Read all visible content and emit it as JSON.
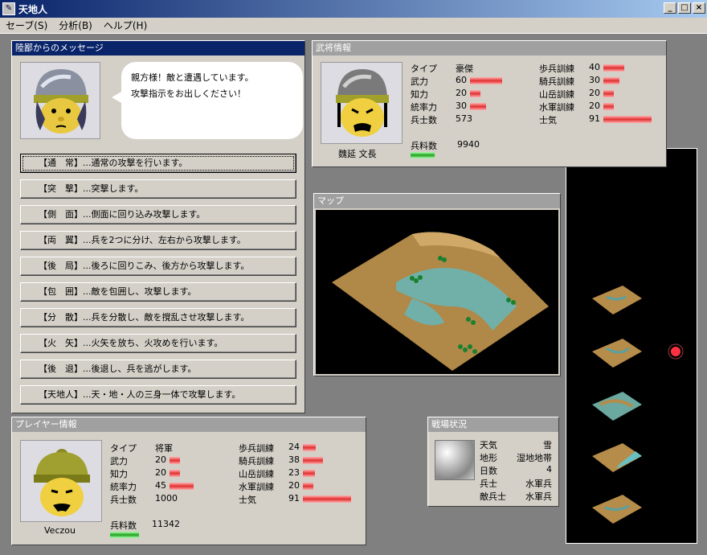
{
  "window": {
    "title": "天地人",
    "min": "_",
    "max": "□",
    "close": "×"
  },
  "menu": [
    "セーブ(S)",
    "分析(B)",
    "ヘルプ(H)"
  ],
  "message": {
    "header": "陸鄙からのメッセージ",
    "line1": "親方様！敵と遭遇しています。",
    "line2": "攻撃指示をお出しください！",
    "commands": [
      "【通　常】...通常の攻撃を行います。",
      "【突　撃】...突撃します。",
      "【側　面】...側面に回り込み攻撃します。",
      "【両　翼】...兵を2つに分け、左右から攻撃します。",
      "【後　局】...後ろに回りこみ、後方から攻撃します。",
      "【包　囲】...敵を包囲し、攻撃します。",
      "【分　散】...兵を分散し、敵を撹乱させ攻撃します。",
      "【火　矢】...火矢を放ち、火攻めを行います。",
      "【後　退】...後退し、兵を逃がします。",
      "【天地人】...天・地・人の三身一体で攻撃します。"
    ]
  },
  "general": {
    "header": "武将情報",
    "name": "魏延 文長",
    "left": [
      {
        "label": "タイプ",
        "value": "豪傑",
        "bar": null
      },
      {
        "label": "武力",
        "value": "60",
        "bar": 0.6
      },
      {
        "label": "知力",
        "value": "20",
        "bar": 0.2
      },
      {
        "label": "統率力",
        "value": "30",
        "bar": 0.3
      },
      {
        "label": "兵士数",
        "value": "573",
        "bar": null
      }
    ],
    "right": [
      {
        "label": "歩兵訓練",
        "value": "40",
        "bar": 0.4
      },
      {
        "label": "騎兵訓練",
        "value": "30",
        "bar": 0.3
      },
      {
        "label": "山岳訓練",
        "value": "20",
        "bar": 0.2
      },
      {
        "label": "水軍訓練",
        "value": "20",
        "bar": 0.2
      },
      {
        "label": "士気",
        "value": "91",
        "bar": 0.91
      }
    ],
    "food_label": "兵料数",
    "food_value": "9940"
  },
  "map": {
    "header": "マップ"
  },
  "player": {
    "header": "プレイヤー情報",
    "name": "Veczou",
    "left": [
      {
        "label": "タイプ",
        "value": "将軍",
        "bar": null
      },
      {
        "label": "武力",
        "value": "20",
        "bar": 0.2
      },
      {
        "label": "知力",
        "value": "20",
        "bar": 0.2
      },
      {
        "label": "統率力",
        "value": "45",
        "bar": 0.45
      },
      {
        "label": "兵士数",
        "value": "1000",
        "bar": null
      }
    ],
    "right": [
      {
        "label": "歩兵訓練",
        "value": "24",
        "bar": 0.24
      },
      {
        "label": "騎兵訓練",
        "value": "38",
        "bar": 0.38
      },
      {
        "label": "山岳訓練",
        "value": "23",
        "bar": 0.23
      },
      {
        "label": "水軍訓練",
        "value": "20",
        "bar": 0.2
      },
      {
        "label": "士気",
        "value": "91",
        "bar": 0.91
      }
    ],
    "food_label": "兵料数",
    "food_value": "11342"
  },
  "battle": {
    "header": "戦場状況",
    "rows": [
      {
        "label": "天気",
        "value": "雪"
      },
      {
        "label": "地形",
        "value": "湿地地帯"
      },
      {
        "label": "日数",
        "value": "4"
      },
      {
        "label": "兵士",
        "value": "水軍兵"
      },
      {
        "label": "敵兵士",
        "value": "水軍兵"
      }
    ]
  },
  "colors": {
    "accent": "#0a246a",
    "bar": "#e03030",
    "food_bar": "#20a020"
  }
}
